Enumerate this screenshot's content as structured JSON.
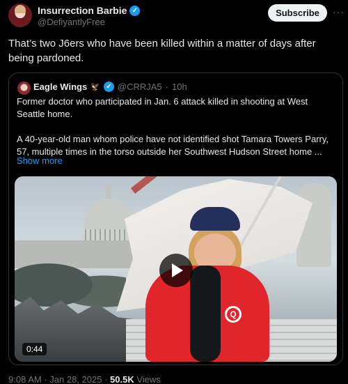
{
  "author": {
    "name": "Insurrection Barbie",
    "handle": "@DefiyantlyFree",
    "verified_icon": "verified-badge-icon",
    "accent": "#1d9bf0"
  },
  "actions": {
    "subscribe_label": "Subscribe",
    "more_label": "···"
  },
  "post": {
    "text": "That’s two J6ers who have been killed within a matter of days after being pardoned."
  },
  "quote": {
    "name": "Eagle Wings",
    "emoji": "🦅",
    "handle": "@CRRJA5",
    "separator": "·",
    "time": "10h",
    "paragraph1": "Former doctor who participated in Jan. 6 attack killed in shooting at West Seattle home.",
    "paragraph2": "A 40-year-old man whom police have not identified shot Tamara Towers Parry, 57, multiple times in the torso outside her Southwest Hudson Street home ...",
    "show_more": "Show more",
    "video": {
      "duration": "0:44",
      "play_icon": "play-icon",
      "badge_letter": "Q"
    }
  },
  "meta": {
    "time": "9:08 AM",
    "dot1": " · ",
    "date": "Jan 28, 2025",
    "dot2": " · ",
    "views_count": "50.5K",
    "views_label": " Views"
  }
}
